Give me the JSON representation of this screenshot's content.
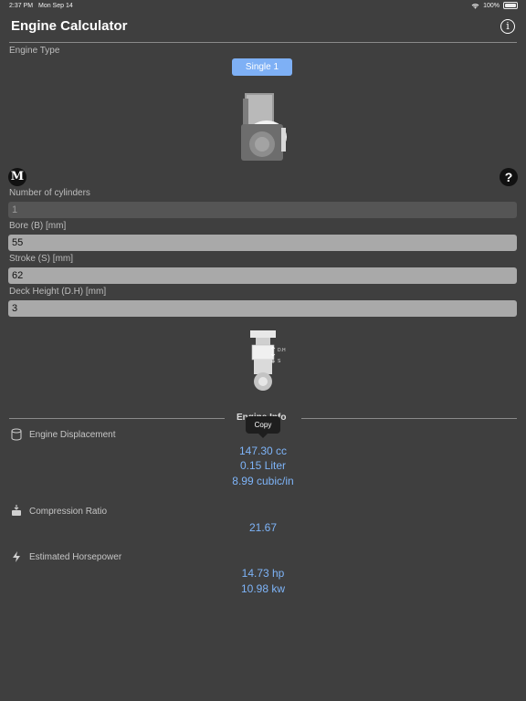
{
  "status": {
    "time": "2:37 PM",
    "date": "Mon Sep 14",
    "battery": "100%"
  },
  "header": {
    "title": "Engine Calculator"
  },
  "engine_type": {
    "label": "Engine Type",
    "selected": "Single 1"
  },
  "inputs": {
    "cylinders": {
      "label": "Number of cylinders",
      "value": "1"
    },
    "bore": {
      "label": "Bore (B) [mm]",
      "value": "55"
    },
    "stroke": {
      "label": "Stroke (S) [mm]",
      "value": "62"
    },
    "deck": {
      "label": "Deck Height (D.H) [mm]",
      "value": "3"
    }
  },
  "buttons": {
    "metric": "M",
    "help": "?"
  },
  "diagram": {
    "dh_label": "D.H",
    "s_label": "S"
  },
  "engine_info": {
    "title": "Engine Info",
    "copy_tooltip": "Copy",
    "displacement": {
      "label": "Engine Displacement",
      "cc": "147.30 cc",
      "liter": "0.15 Liter",
      "cubic": "8.99 cubic/in"
    },
    "compression": {
      "label": "Compression Ratio",
      "value": "21.67"
    },
    "horsepower": {
      "label": "Estimated Horsepower",
      "hp": "14.73 hp",
      "kw": "10.98 kw"
    }
  }
}
